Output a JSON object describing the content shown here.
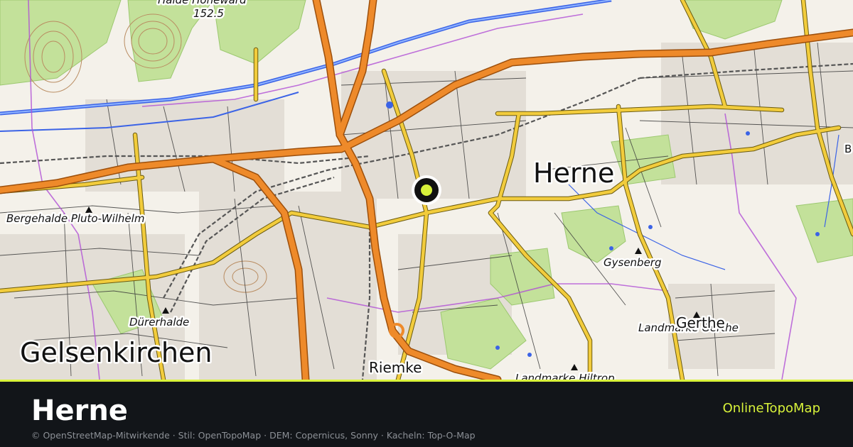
{
  "colors": {
    "footer_bg": "#121519",
    "accent": "#d8f23a",
    "title": "#ffffff",
    "attribution": "#8c9096",
    "marker_fill": "#d8f23a",
    "marker_ring": "#111111",
    "motorway": "#ee8a2a",
    "primary_road": "#f2cc3c",
    "minor_road": "#3a3a3a",
    "water": "#3b63e6",
    "forest": "#b9dc8e",
    "boundary": "#b04fd6"
  },
  "map": {
    "marker": {
      "icon": "location-marker-icon",
      "name": "Herne"
    },
    "labels": [
      {
        "id": "halde-hoheward",
        "text": "Halde Hoheward"
      },
      {
        "id": "halde-elevation",
        "text": "152.5"
      },
      {
        "id": "herne",
        "text": "Herne"
      },
      {
        "id": "bergehalde-pluto-wilhelm",
        "text": "Bergehalde Pluto-Wilhelm"
      },
      {
        "id": "gysenberg",
        "text": "Gysenberg"
      },
      {
        "id": "duererhalde",
        "text": "Dürerhalde"
      },
      {
        "id": "gelsenkirchen",
        "text": "Gelsenkirchen"
      },
      {
        "id": "riemke",
        "text": "Riemke"
      },
      {
        "id": "landmarke-gerthe",
        "text": "Landmarke Gerthe"
      },
      {
        "id": "gerthe",
        "text": "Gerthe"
      },
      {
        "id": "landmarke-hiltrop",
        "text": "Landmarke Hiltrop"
      },
      {
        "id": "edge-b",
        "text": "B"
      }
    ]
  },
  "footer": {
    "title": "Herne",
    "brand": "OnlineTopoMap",
    "attribution": "© OpenStreetMap-Mitwirkende · Stil: OpenTopoMap · DEM: Copernicus, Sonny · Kacheln: Top-O-Map"
  }
}
